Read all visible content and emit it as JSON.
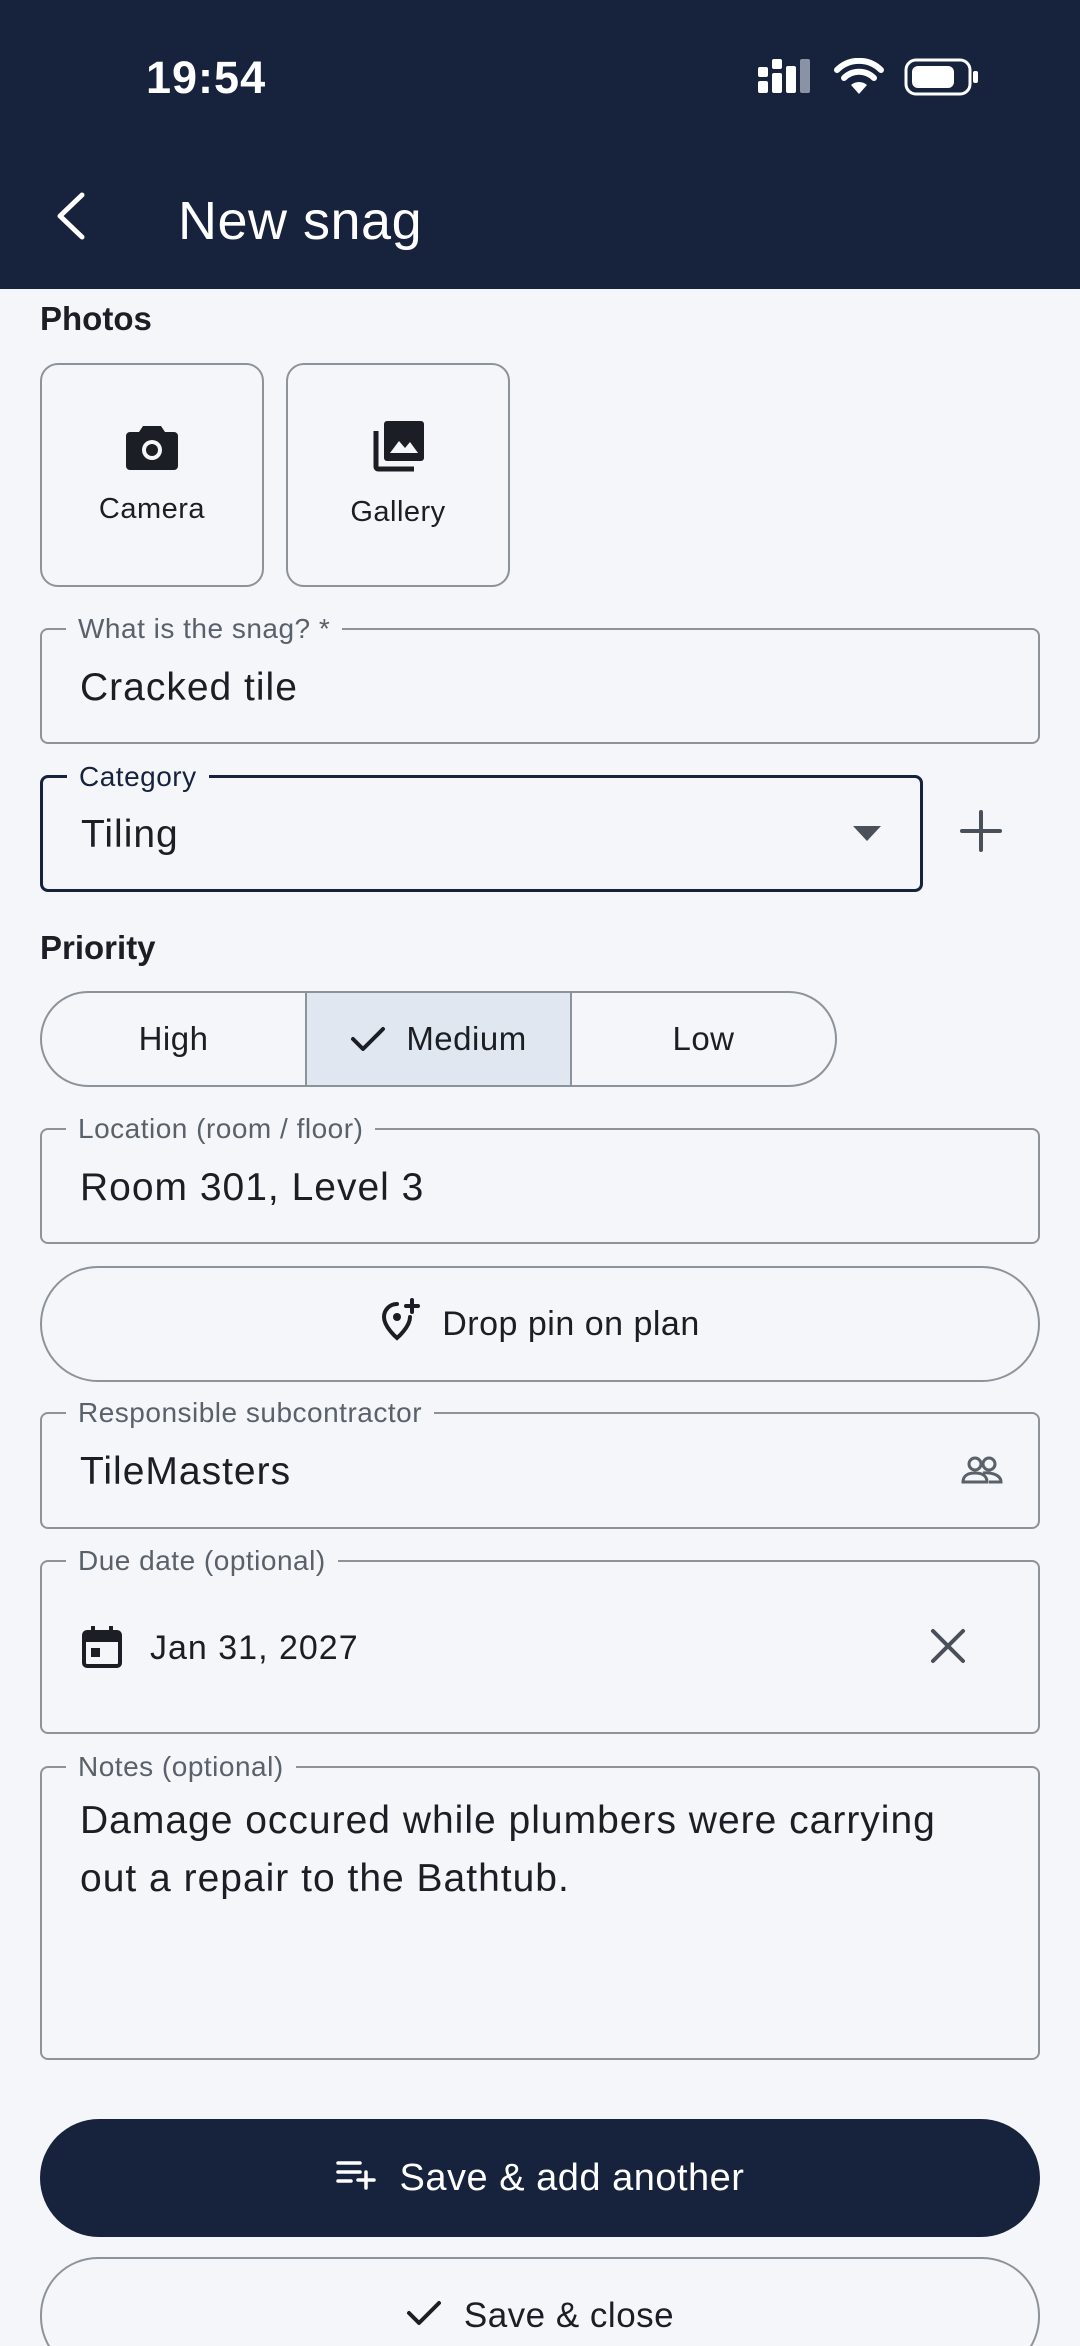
{
  "status_bar": {
    "time": "19:54"
  },
  "header": {
    "title": "New snag"
  },
  "photos": {
    "label": "Photos",
    "camera_label": "Camera",
    "gallery_label": "Gallery"
  },
  "snag_field": {
    "label": "What is the snag? *",
    "value": "Cracked tile"
  },
  "category_field": {
    "label": "Category",
    "value": "Tiling"
  },
  "priority": {
    "label": "Priority",
    "options": [
      "High",
      "Medium",
      "Low"
    ],
    "selected": "Medium"
  },
  "location_field": {
    "label": "Location (room / floor)",
    "value": "Room 301, Level 3"
  },
  "drop_pin_button": {
    "label": "Drop pin on plan"
  },
  "subcontractor_field": {
    "label": "Responsible subcontractor",
    "value": "TileMasters"
  },
  "due_date_field": {
    "label": "Due date (optional)",
    "value": "Jan 31, 2027"
  },
  "notes_field": {
    "label": "Notes (optional)",
    "value": "Damage occured while plumbers were carrying out a repair to the Bathtub."
  },
  "actions": {
    "save_add_another": "Save & add another",
    "save_close": "Save & close"
  },
  "colors": {
    "primary": "#17223d",
    "background": "#f4f6f9",
    "outline": "#8d939b",
    "selected_segment": "#e1e7f0"
  },
  "icons": {
    "camera": "camera-icon",
    "gallery": "gallery-icon",
    "back": "back-arrow-icon",
    "add": "plus-icon",
    "dropdown": "dropdown-arrow-icon",
    "check": "check-icon",
    "pin": "add-location-icon",
    "group": "people-icon",
    "calendar": "calendar-icon",
    "clear": "close-icon",
    "playlist_add": "playlist-add-icon"
  }
}
